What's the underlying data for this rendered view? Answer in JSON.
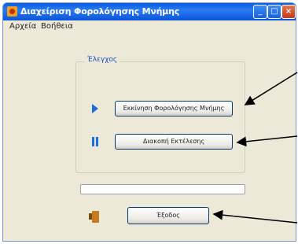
{
  "window": {
    "title": "Διαχείριση Φορολόγησης Μνήμης"
  },
  "menubar": {
    "items": [
      "Αρχεία",
      "Βοήθεια"
    ]
  },
  "group": {
    "label": "Έλεγχος"
  },
  "buttons": {
    "start": "Εκκίνηση Φορολόγησης Μνήμης",
    "stop": "Διακοπή Εκτέλεσης",
    "exit": "Έξοδος"
  },
  "progress": {
    "value": 0
  },
  "colors": {
    "title_bar": "#0a5ce0",
    "accent_icon": "#1a6fe0",
    "arrow": "#000000"
  },
  "icons": {
    "app": "app-icon",
    "start": "play-icon",
    "stop": "pause-icon",
    "exit": "door-exit-icon"
  }
}
